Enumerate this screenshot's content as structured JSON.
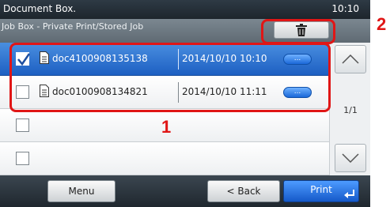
{
  "header": {
    "title": "Document Box.",
    "time": "10:10",
    "subtitle": "Job Box - Private Print/Stored Job"
  },
  "toolbar": {
    "delete_icon": "trash-icon"
  },
  "jobs": [
    {
      "name": "doc4100908135138",
      "date": "2014/10/10 10:10",
      "checked": true,
      "detail_label": "..."
    },
    {
      "name": "doc0100908134821",
      "date": "2014/10/10 11:11",
      "checked": false,
      "detail_label": "..."
    },
    {
      "name": "",
      "date": "",
      "checked": false
    },
    {
      "name": "",
      "date": "",
      "checked": false
    }
  ],
  "pager": {
    "indicator": "1/1"
  },
  "footer": {
    "menu_label": "Menu",
    "back_label": "< Back",
    "print_label": "Print"
  },
  "annotations": {
    "list_number": "1",
    "delete_number": "2"
  },
  "colors": {
    "selected_row": "#1d5fc2",
    "callout": "#e01616",
    "print_button": "#1559c9"
  }
}
